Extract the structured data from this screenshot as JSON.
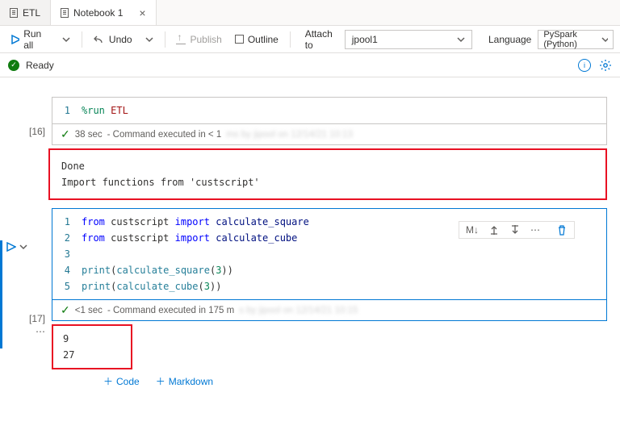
{
  "tabs": [
    {
      "label": "ETL"
    },
    {
      "label": "Notebook 1"
    }
  ],
  "toolbar": {
    "run_all": "Run all",
    "undo": "Undo",
    "publish": "Publish",
    "outline": "Outline",
    "attach_label": "Attach to",
    "attach_value": "jpool1",
    "language_label": "Language",
    "language_value": "PySpark (Python)"
  },
  "status": {
    "text": "Ready"
  },
  "cell1": {
    "exec": "[16]",
    "lineno": "1",
    "cmd": "%run",
    "arg": "ETL",
    "meta_time": "38 sec",
    "meta_text": "- Command executed in < 1",
    "meta_blur": "ms by jipool on 12/14/21 10:13",
    "output_l1": "Done",
    "output_l2": "Import functions from 'custscript'"
  },
  "floatbar": {
    "convert": "M↓"
  },
  "cell2": {
    "exec": "[17]",
    "l1a": "from",
    "l1b": "custscript",
    "l1c": "import",
    "l1d": "calculate_square",
    "l2a": "from",
    "l2b": "custscript",
    "l2c": "import",
    "l2d": "calculate_cube",
    "l4a": "print",
    "l4b": "calculate_square",
    "l4n": "3",
    "l5a": "print",
    "l5b": "calculate_cube",
    "l5n": "3",
    "ln1": "1",
    "ln2": "2",
    "ln3": "3",
    "ln4": "4",
    "ln5": "5",
    "meta_time": "<1 sec",
    "meta_text": "- Command executed in 175 m",
    "meta_blur": "s by jipool on 12/14/21 10:15",
    "out1": "9",
    "out2": "27"
  },
  "add": {
    "code": "Code",
    "markdown": "Markdown"
  }
}
